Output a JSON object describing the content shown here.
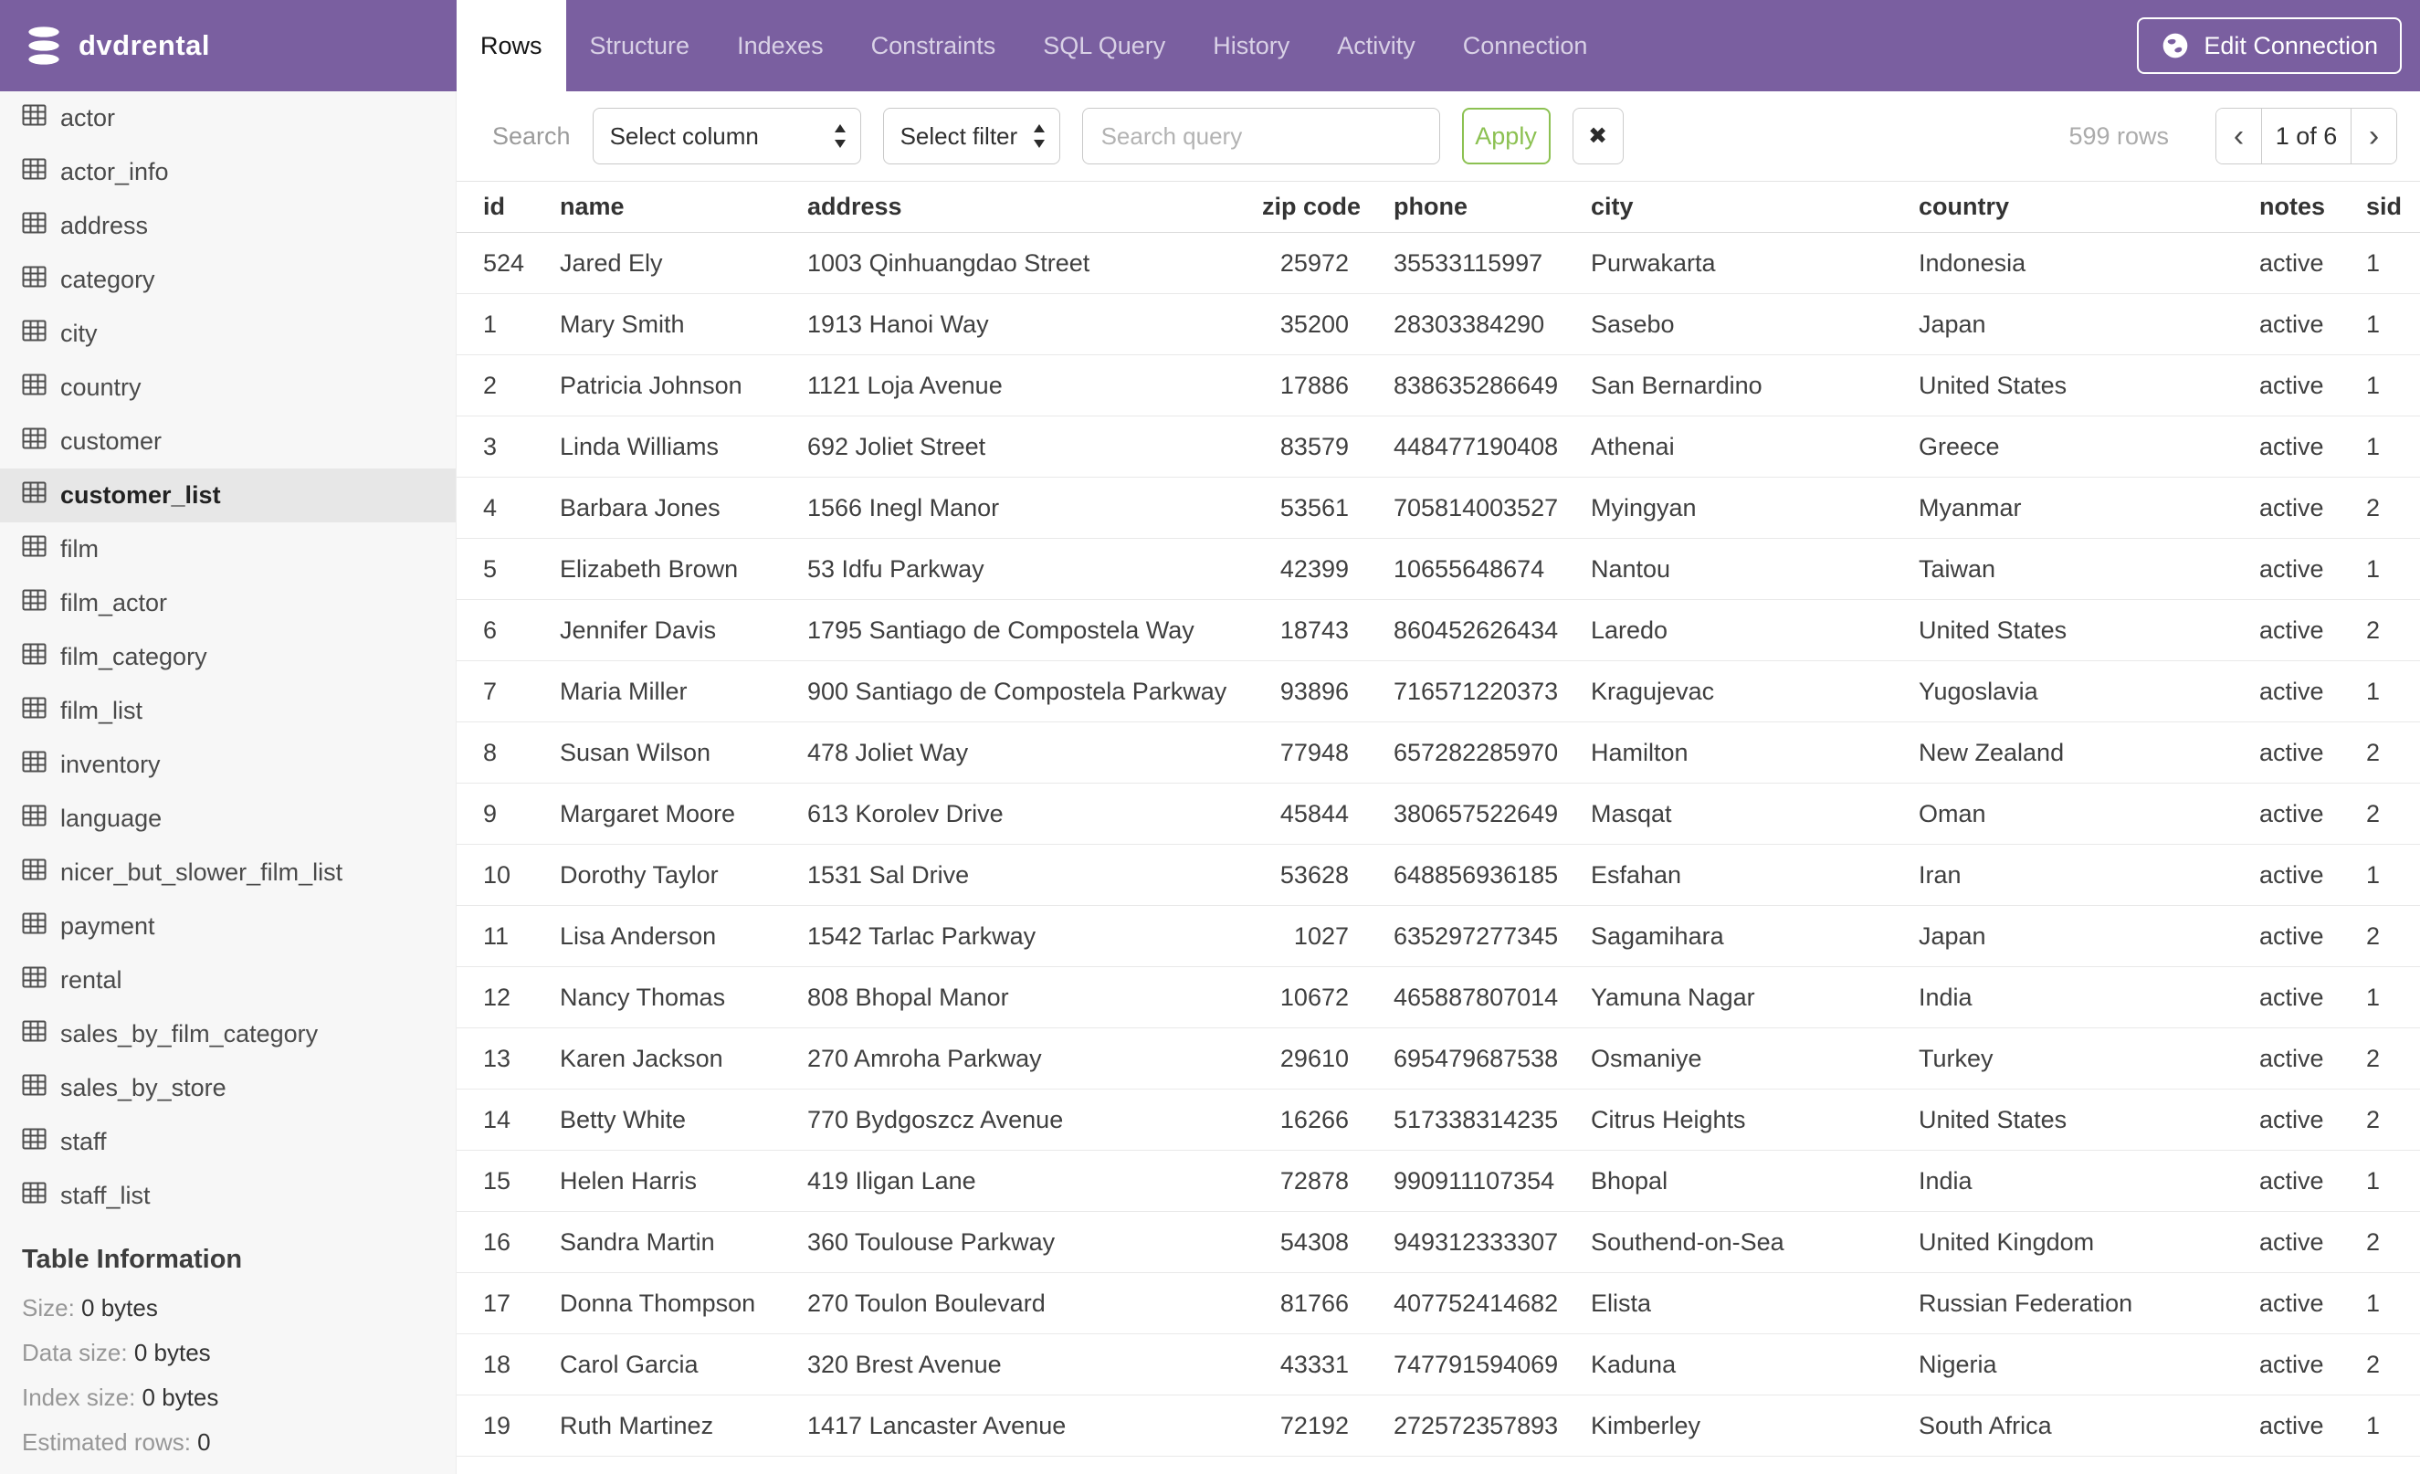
{
  "app": {
    "database": "dvdrental",
    "tabs": [
      {
        "label": "Rows",
        "active": true
      },
      {
        "label": "Structure",
        "active": false
      },
      {
        "label": "Indexes",
        "active": false
      },
      {
        "label": "Constraints",
        "active": false
      },
      {
        "label": "SQL Query",
        "active": false
      },
      {
        "label": "History",
        "active": false
      },
      {
        "label": "Activity",
        "active": false
      },
      {
        "label": "Connection",
        "active": false
      }
    ],
    "edit_connection_label": "Edit Connection"
  },
  "sidebar": {
    "tables": [
      {
        "name": "actor",
        "selected": false
      },
      {
        "name": "actor_info",
        "selected": false
      },
      {
        "name": "address",
        "selected": false
      },
      {
        "name": "category",
        "selected": false
      },
      {
        "name": "city",
        "selected": false
      },
      {
        "name": "country",
        "selected": false
      },
      {
        "name": "customer",
        "selected": false
      },
      {
        "name": "customer_list",
        "selected": true
      },
      {
        "name": "film",
        "selected": false
      },
      {
        "name": "film_actor",
        "selected": false
      },
      {
        "name": "film_category",
        "selected": false
      },
      {
        "name": "film_list",
        "selected": false
      },
      {
        "name": "inventory",
        "selected": false
      },
      {
        "name": "language",
        "selected": false
      },
      {
        "name": "nicer_but_slower_film_list",
        "selected": false
      },
      {
        "name": "payment",
        "selected": false
      },
      {
        "name": "rental",
        "selected": false
      },
      {
        "name": "sales_by_film_category",
        "selected": false
      },
      {
        "name": "sales_by_store",
        "selected": false
      },
      {
        "name": "staff",
        "selected": false
      },
      {
        "name": "staff_list",
        "selected": false
      }
    ],
    "table_information": {
      "title": "Table Information",
      "rows": [
        {
          "label": "Size:",
          "value": "0 bytes"
        },
        {
          "label": "Data size:",
          "value": "0 bytes"
        },
        {
          "label": "Index size:",
          "value": "0 bytes"
        },
        {
          "label": "Estimated rows:",
          "value": "0"
        }
      ]
    }
  },
  "toolbar": {
    "search_label": "Search",
    "select_column_value": "Select column",
    "select_filter_value": "Select filter",
    "search_query_placeholder": "Search query",
    "search_query_value": "",
    "apply_label": "Apply",
    "clear_label": "✖",
    "rows_count": "599 rows",
    "pagination": {
      "prev": "‹",
      "current": "1 of 6",
      "next": "›"
    }
  },
  "grid": {
    "columns": [
      {
        "label": "id",
        "align": "left"
      },
      {
        "label": "name",
        "align": "left"
      },
      {
        "label": "address",
        "align": "left"
      },
      {
        "label": "zip code",
        "align": "right"
      },
      {
        "label": "phone",
        "align": "left"
      },
      {
        "label": "city",
        "align": "left"
      },
      {
        "label": "country",
        "align": "left"
      },
      {
        "label": "notes",
        "align": "left"
      },
      {
        "label": "sid",
        "align": "left"
      }
    ],
    "rows": [
      [
        "524",
        "Jared Ely",
        "1003 Qinhuangdao Street",
        "25972",
        "35533115997",
        "Purwakarta",
        "Indonesia",
        "active",
        "1"
      ],
      [
        "1",
        "Mary Smith",
        "1913 Hanoi Way",
        "35200",
        "28303384290",
        "Sasebo",
        "Japan",
        "active",
        "1"
      ],
      [
        "2",
        "Patricia Johnson",
        "1121 Loja Avenue",
        "17886",
        "838635286649",
        "San Bernardino",
        "United States",
        "active",
        "1"
      ],
      [
        "3",
        "Linda Williams",
        "692 Joliet Street",
        "83579",
        "448477190408",
        "Athenai",
        "Greece",
        "active",
        "1"
      ],
      [
        "4",
        "Barbara Jones",
        "1566 Inegl Manor",
        "53561",
        "705814003527",
        "Myingyan",
        "Myanmar",
        "active",
        "2"
      ],
      [
        "5",
        "Elizabeth Brown",
        "53 Idfu Parkway",
        "42399",
        "10655648674",
        "Nantou",
        "Taiwan",
        "active",
        "1"
      ],
      [
        "6",
        "Jennifer Davis",
        "1795 Santiago de Compostela Way",
        "18743",
        "860452626434",
        "Laredo",
        "United States",
        "active",
        "2"
      ],
      [
        "7",
        "Maria Miller",
        "900 Santiago de Compostela Parkway",
        "93896",
        "716571220373",
        "Kragujevac",
        "Yugoslavia",
        "active",
        "1"
      ],
      [
        "8",
        "Susan Wilson",
        "478 Joliet Way",
        "77948",
        "657282285970",
        "Hamilton",
        "New Zealand",
        "active",
        "2"
      ],
      [
        "9",
        "Margaret Moore",
        "613 Korolev Drive",
        "45844",
        "380657522649",
        "Masqat",
        "Oman",
        "active",
        "2"
      ],
      [
        "10",
        "Dorothy Taylor",
        "1531 Sal Drive",
        "53628",
        "648856936185",
        "Esfahan",
        "Iran",
        "active",
        "1"
      ],
      [
        "11",
        "Lisa Anderson",
        "1542 Tarlac Parkway",
        "1027",
        "635297277345",
        "Sagamihara",
        "Japan",
        "active",
        "2"
      ],
      [
        "12",
        "Nancy Thomas",
        "808 Bhopal Manor",
        "10672",
        "465887807014",
        "Yamuna Nagar",
        "India",
        "active",
        "1"
      ],
      [
        "13",
        "Karen Jackson",
        "270 Amroha Parkway",
        "29610",
        "695479687538",
        "Osmaniye",
        "Turkey",
        "active",
        "2"
      ],
      [
        "14",
        "Betty White",
        "770 Bydgoszcz Avenue",
        "16266",
        "517338314235",
        "Citrus Heights",
        "United States",
        "active",
        "2"
      ],
      [
        "15",
        "Helen Harris",
        "419 Iligan Lane",
        "72878",
        "990911107354",
        "Bhopal",
        "India",
        "active",
        "1"
      ],
      [
        "16",
        "Sandra Martin",
        "360 Toulouse Parkway",
        "54308",
        "949312333307",
        "Southend-on-Sea",
        "United Kingdom",
        "active",
        "2"
      ],
      [
        "17",
        "Donna Thompson",
        "270 Toulon Boulevard",
        "81766",
        "407752414682",
        "Elista",
        "Russian Federation",
        "active",
        "1"
      ],
      [
        "18",
        "Carol Garcia",
        "320 Brest Avenue",
        "43331",
        "747791594069",
        "Kaduna",
        "Nigeria",
        "active",
        "2"
      ],
      [
        "19",
        "Ruth Martinez",
        "1417 Lancaster Avenue",
        "72192",
        "272572357893",
        "Kimberley",
        "South Africa",
        "active",
        "1"
      ]
    ]
  },
  "colors": {
    "brand_purple": "#7A5FA0",
    "apply_green": "#8CC152",
    "sidebar_bg": "#F7F7F7",
    "selected_item_bg": "#E7E7E7"
  },
  "icons": {
    "logo": "database-icon",
    "edit_connection": "globe-icon",
    "sidebar_item": "table-grid-icon",
    "select": "updown-arrows-icon",
    "clear": "x-icon"
  }
}
